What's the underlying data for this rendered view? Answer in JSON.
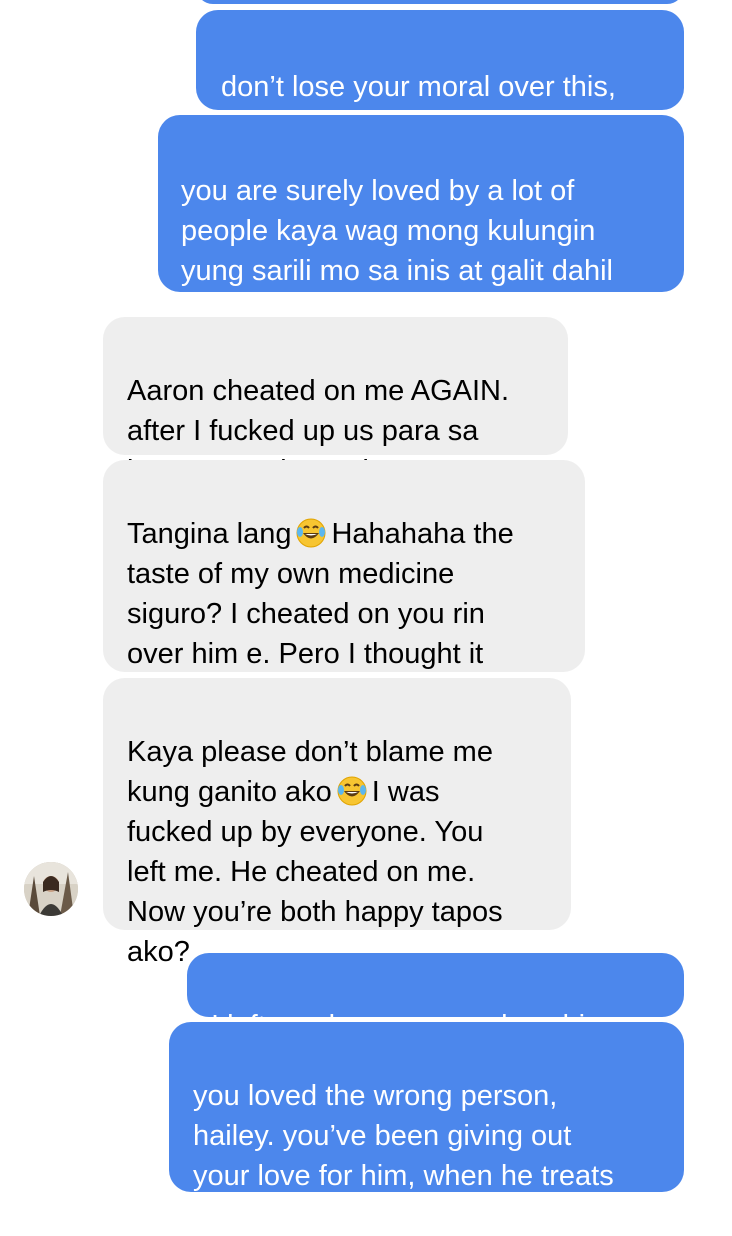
{
  "conversation": {
    "messages": [
      {
        "direction": "outgoing",
        "text": "don’t lose your moral over this,\nhailey. you are more than that."
      },
      {
        "direction": "outgoing",
        "text": "you are surely loved by a lot of\npeople kaya wag mong kulungin\nyung sarili mo sa inis at galit dahil\nsa mga bagay na nangyari."
      },
      {
        "direction": "incoming",
        "text": "Aaron cheated on me AGAIN.\nafter I fucked up us para sa\nkanya. He cheated on me."
      },
      {
        "direction": "incoming",
        "text_before_emoji": "Tangina lang",
        "emoji": "face-with-tears-of-joy",
        "text_after_emoji": "Hahahaha the\ntaste of my own medicine\nsiguro? I cheated on you rin\nover him e. Pero I thought it\nwouldnt happen anymore"
      },
      {
        "direction": "incoming",
        "text_before_emoji": "Kaya please don’t blame me\nkung ganito ako",
        "emoji": "face-with-tears-of-joy",
        "text_after_emoji": "I was\nfucked up by everyone. You\nleft me. He cheated on me.\nNow you’re both happy tapos\nako?"
      },
      {
        "direction": "outgoing",
        "text": "I left you because you love him."
      },
      {
        "direction": "outgoing",
        "text": "you loved the wrong person,\nhailey. you’ve been giving out\nyour love for him, when he treats\nyou like trash."
      }
    ],
    "avatar": "contact-avatar-photo",
    "colors": {
      "outgoing_bubble": "#4c87ec",
      "incoming_bubble": "#eeeeee",
      "outgoing_text": "#ffffff",
      "incoming_text": "#000000"
    }
  }
}
